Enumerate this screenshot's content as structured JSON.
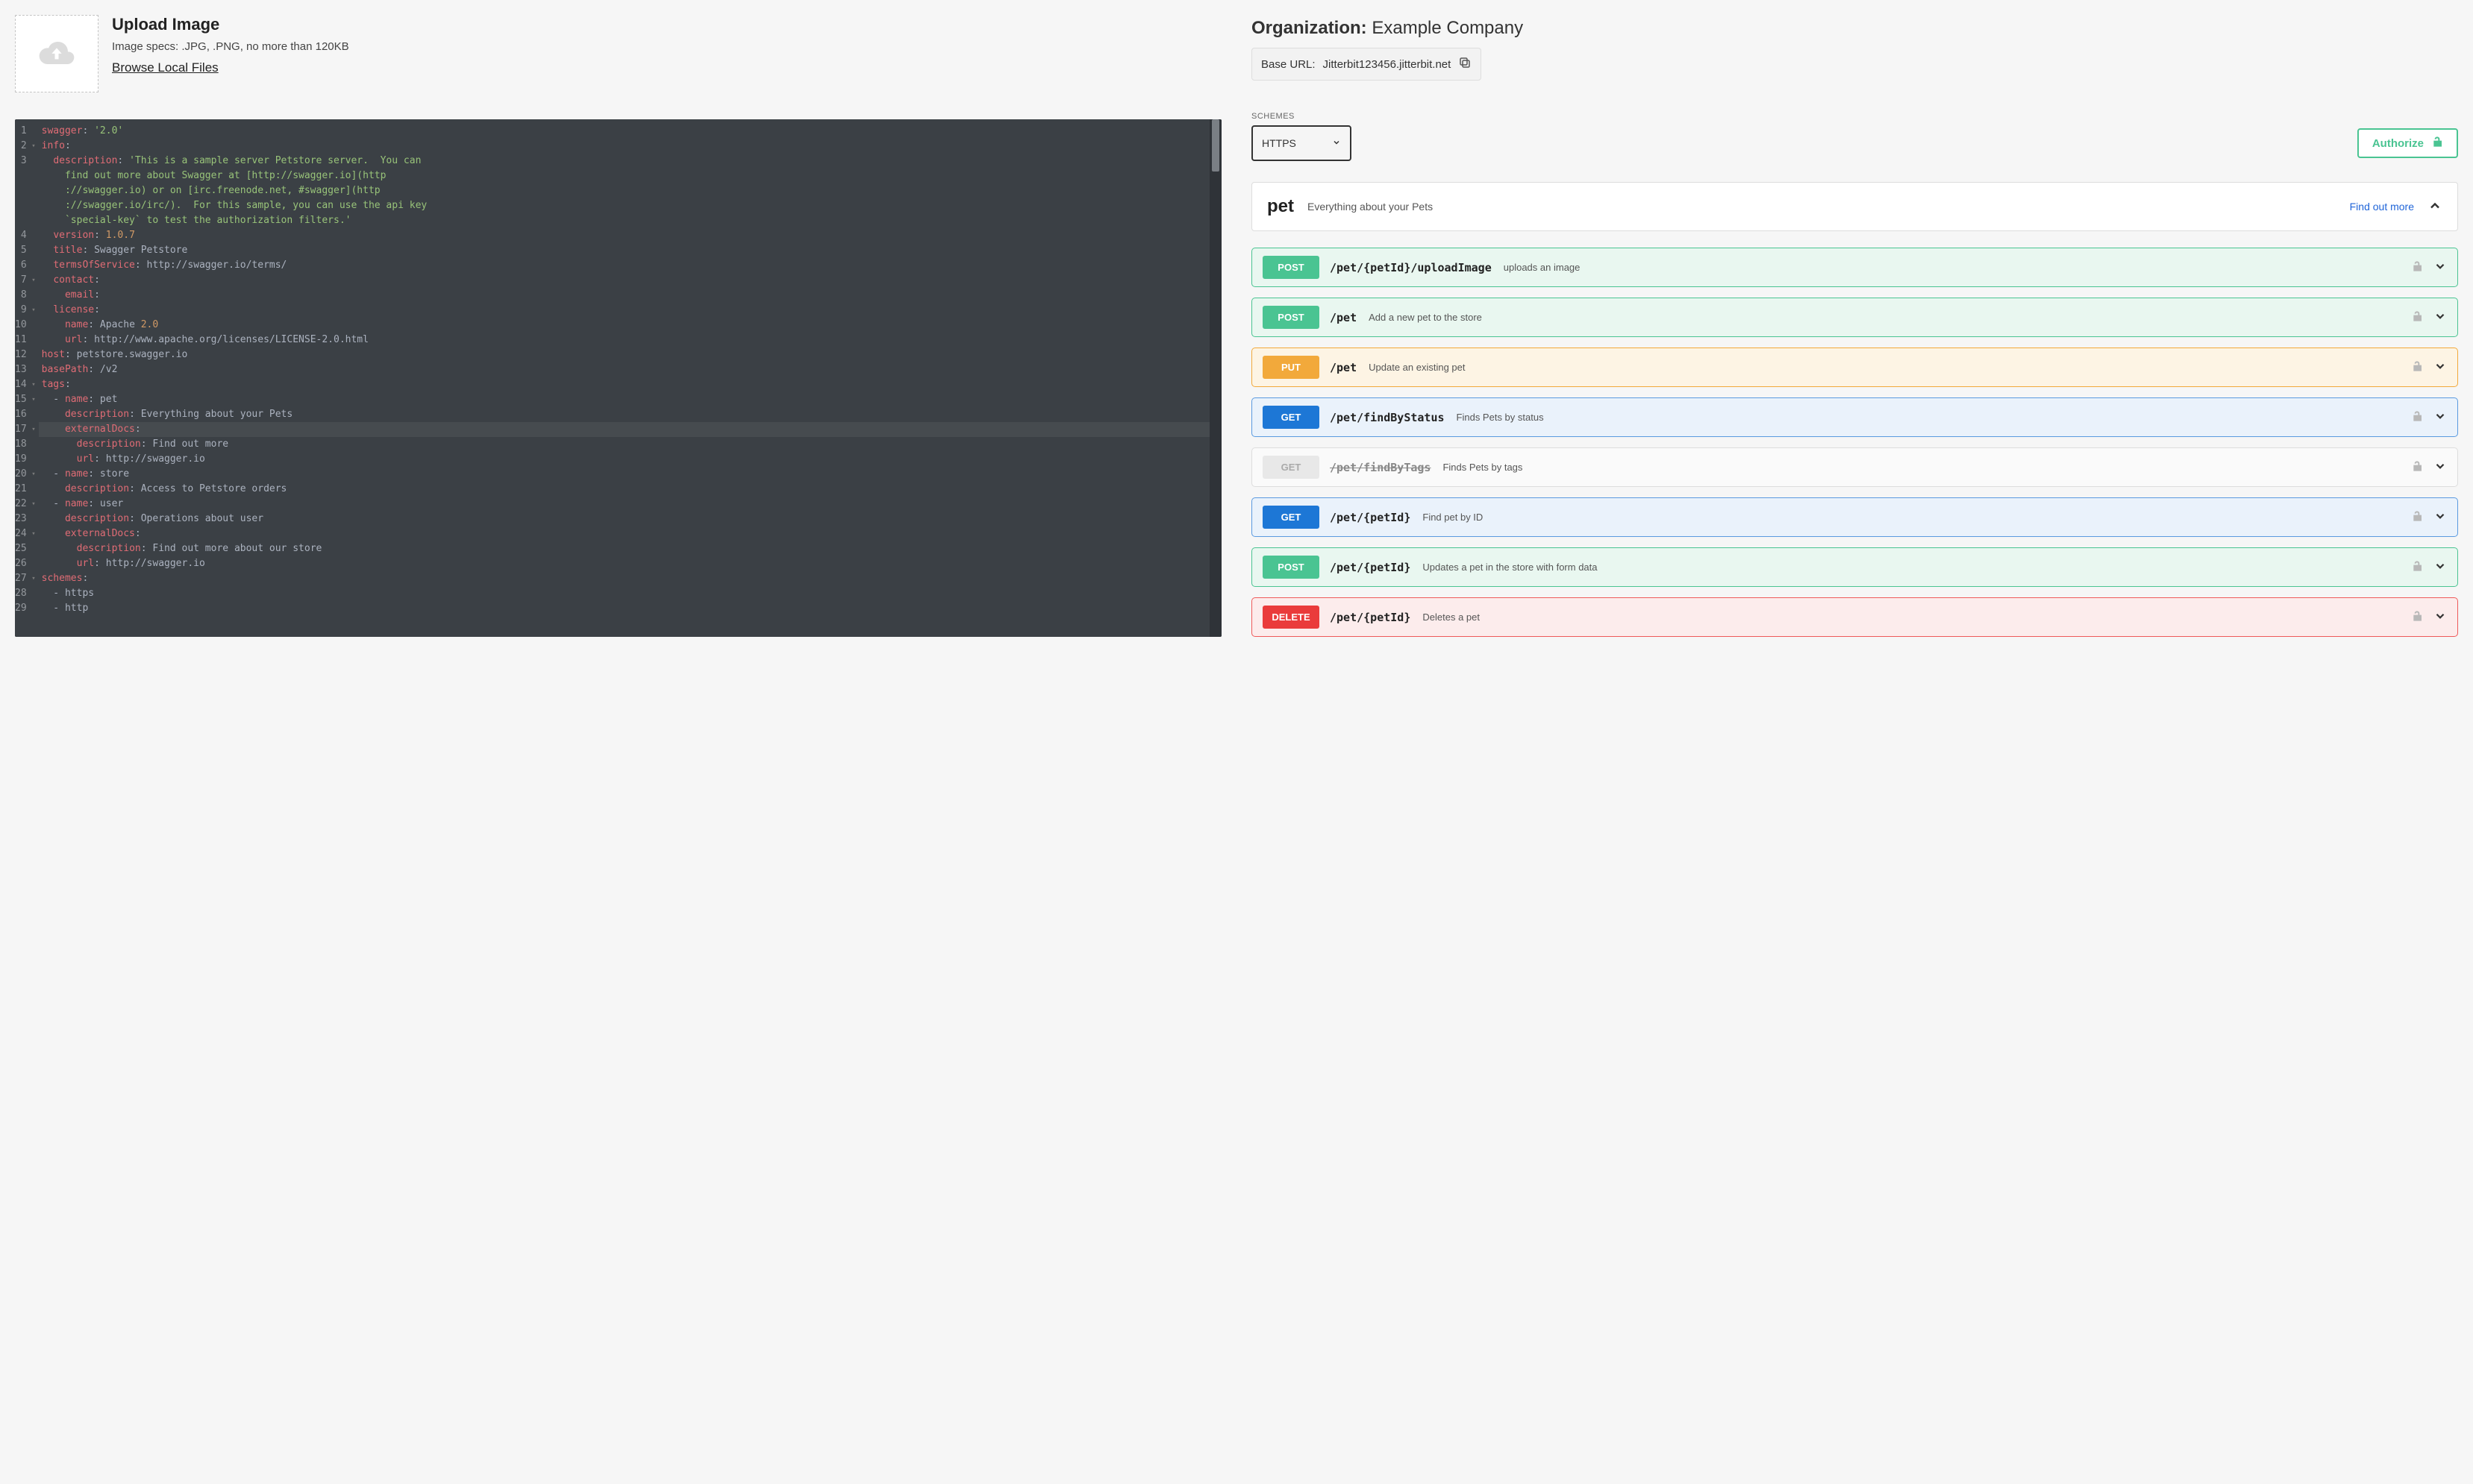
{
  "upload": {
    "title": "Upload Image",
    "specs": "Image specs: .JPG, .PNG, no more than 120KB",
    "browse": "Browse Local Files"
  },
  "editor": {
    "lines": [
      {
        "n": 1,
        "fold": false,
        "hl": false,
        "t": [
          [
            "k",
            "swagger"
          ],
          [
            "p",
            ": "
          ],
          [
            "s",
            "'2.0'"
          ]
        ]
      },
      {
        "n": 2,
        "fold": true,
        "hl": false,
        "t": [
          [
            "k",
            "info"
          ],
          [
            "p",
            ":"
          ]
        ]
      },
      {
        "n": 3,
        "fold": false,
        "hl": false,
        "t": [
          [
            "p",
            "  "
          ],
          [
            "k",
            "description"
          ],
          [
            "p",
            ": "
          ],
          [
            "s",
            "'This is a sample server Petstore server.  You can"
          ]
        ]
      },
      {
        "n": 0,
        "fold": false,
        "hl": false,
        "t": [
          [
            "s",
            "    find out more about Swagger at [http://swagger.io](http"
          ]
        ]
      },
      {
        "n": 0,
        "fold": false,
        "hl": false,
        "t": [
          [
            "s",
            "    ://swagger.io) or on [irc.freenode.net, #swagger](http"
          ]
        ]
      },
      {
        "n": 0,
        "fold": false,
        "hl": false,
        "t": [
          [
            "s",
            "    ://swagger.io/irc/).  For this sample, you can use the api key"
          ]
        ]
      },
      {
        "n": 0,
        "fold": false,
        "hl": false,
        "t": [
          [
            "s",
            "    `special-key` to test the authorization filters.'"
          ]
        ]
      },
      {
        "n": 4,
        "fold": false,
        "hl": false,
        "t": [
          [
            "p",
            "  "
          ],
          [
            "k",
            "version"
          ],
          [
            "p",
            ": "
          ],
          [
            "n",
            "1.0.7"
          ]
        ]
      },
      {
        "n": 5,
        "fold": false,
        "hl": false,
        "t": [
          [
            "p",
            "  "
          ],
          [
            "k",
            "title"
          ],
          [
            "p",
            ": Swagger Petstore"
          ]
        ]
      },
      {
        "n": 6,
        "fold": false,
        "hl": false,
        "t": [
          [
            "p",
            "  "
          ],
          [
            "k",
            "termsOfService"
          ],
          [
            "p",
            ": http://swagger.io/terms/"
          ]
        ]
      },
      {
        "n": 7,
        "fold": true,
        "hl": false,
        "t": [
          [
            "p",
            "  "
          ],
          [
            "k",
            "contact"
          ],
          [
            "p",
            ":"
          ]
        ]
      },
      {
        "n": 8,
        "fold": false,
        "hl": false,
        "t": [
          [
            "p",
            "    "
          ],
          [
            "k",
            "email"
          ],
          [
            "p",
            ":"
          ]
        ]
      },
      {
        "n": 9,
        "fold": true,
        "hl": false,
        "t": [
          [
            "p",
            "  "
          ],
          [
            "k",
            "license"
          ],
          [
            "p",
            ":"
          ]
        ]
      },
      {
        "n": 10,
        "fold": false,
        "hl": false,
        "t": [
          [
            "p",
            "    "
          ],
          [
            "k",
            "name"
          ],
          [
            "p",
            ": Apache "
          ],
          [
            "n",
            "2.0"
          ]
        ]
      },
      {
        "n": 11,
        "fold": false,
        "hl": false,
        "t": [
          [
            "p",
            "    "
          ],
          [
            "k",
            "url"
          ],
          [
            "p",
            ": http://www.apache.org/licenses/LICENSE-2.0.html"
          ]
        ]
      },
      {
        "n": 12,
        "fold": false,
        "hl": false,
        "t": [
          [
            "k",
            "host"
          ],
          [
            "p",
            ": petstore.swagger.io"
          ]
        ]
      },
      {
        "n": 13,
        "fold": false,
        "hl": false,
        "t": [
          [
            "k",
            "basePath"
          ],
          [
            "p",
            ": /v2"
          ]
        ]
      },
      {
        "n": 14,
        "fold": true,
        "hl": false,
        "t": [
          [
            "k",
            "tags"
          ],
          [
            "p",
            ":"
          ]
        ]
      },
      {
        "n": 15,
        "fold": true,
        "hl": false,
        "t": [
          [
            "p",
            "  - "
          ],
          [
            "k",
            "name"
          ],
          [
            "p",
            ": pet"
          ]
        ]
      },
      {
        "n": 16,
        "fold": false,
        "hl": false,
        "t": [
          [
            "p",
            "    "
          ],
          [
            "k",
            "description"
          ],
          [
            "p",
            ": Everything about your Pets"
          ]
        ]
      },
      {
        "n": 17,
        "fold": true,
        "hl": true,
        "t": [
          [
            "p",
            "    "
          ],
          [
            "k",
            "externalDocs"
          ],
          [
            "p",
            ":"
          ]
        ]
      },
      {
        "n": 18,
        "fold": false,
        "hl": false,
        "t": [
          [
            "p",
            "      "
          ],
          [
            "k",
            "description"
          ],
          [
            "p",
            ": Find out more"
          ]
        ]
      },
      {
        "n": 19,
        "fold": false,
        "hl": false,
        "t": [
          [
            "p",
            "      "
          ],
          [
            "k",
            "url"
          ],
          [
            "p",
            ": http://swagger.io"
          ]
        ]
      },
      {
        "n": 20,
        "fold": true,
        "hl": false,
        "t": [
          [
            "p",
            "  - "
          ],
          [
            "k",
            "name"
          ],
          [
            "p",
            ": store"
          ]
        ]
      },
      {
        "n": 21,
        "fold": false,
        "hl": false,
        "t": [
          [
            "p",
            "    "
          ],
          [
            "k",
            "description"
          ],
          [
            "p",
            ": Access to Petstore orders"
          ]
        ]
      },
      {
        "n": 22,
        "fold": true,
        "hl": false,
        "t": [
          [
            "p",
            "  - "
          ],
          [
            "k",
            "name"
          ],
          [
            "p",
            ": user"
          ]
        ]
      },
      {
        "n": 23,
        "fold": false,
        "hl": false,
        "t": [
          [
            "p",
            "    "
          ],
          [
            "k",
            "description"
          ],
          [
            "p",
            ": Operations about user"
          ]
        ]
      },
      {
        "n": 24,
        "fold": true,
        "hl": false,
        "t": [
          [
            "p",
            "    "
          ],
          [
            "k",
            "externalDocs"
          ],
          [
            "p",
            ":"
          ]
        ]
      },
      {
        "n": 25,
        "fold": false,
        "hl": false,
        "t": [
          [
            "p",
            "      "
          ],
          [
            "k",
            "description"
          ],
          [
            "p",
            ": Find out more about our store"
          ]
        ]
      },
      {
        "n": 26,
        "fold": false,
        "hl": false,
        "t": [
          [
            "p",
            "      "
          ],
          [
            "k",
            "url"
          ],
          [
            "p",
            ": http://swagger.io"
          ]
        ]
      },
      {
        "n": 27,
        "fold": true,
        "hl": false,
        "t": [
          [
            "k",
            "schemes"
          ],
          [
            "p",
            ":"
          ]
        ]
      },
      {
        "n": 28,
        "fold": false,
        "hl": false,
        "t": [
          [
            "p",
            "  - https"
          ]
        ]
      },
      {
        "n": 29,
        "fold": false,
        "hl": false,
        "t": [
          [
            "p",
            "  - http"
          ]
        ]
      }
    ]
  },
  "org": {
    "label": "Organization:",
    "name": "Example Company",
    "base_url_label": "Base URL:",
    "base_url_value": "Jitterbit123456.jitterbit.net"
  },
  "schemes": {
    "label": "SCHEMES",
    "selected": "HTTPS"
  },
  "authorize_label": "Authorize",
  "tag": {
    "name": "pet",
    "description": "Everything about your Pets",
    "find_out_more": "Find out more"
  },
  "operations": [
    {
      "method": "POST",
      "cls": "post",
      "path": "/pet/{petId}/uploadImage",
      "summary": "uploads an image",
      "deprecated": false
    },
    {
      "method": "POST",
      "cls": "post",
      "path": "/pet",
      "summary": "Add a new pet to the store",
      "deprecated": false
    },
    {
      "method": "PUT",
      "cls": "put",
      "path": "/pet",
      "summary": "Update an existing pet",
      "deprecated": false
    },
    {
      "method": "GET",
      "cls": "get",
      "path": "/pet/findByStatus",
      "summary": "Finds Pets by status",
      "deprecated": false
    },
    {
      "method": "GET",
      "cls": "get",
      "path": "/pet/findByTags",
      "summary": "Finds Pets by tags",
      "deprecated": true
    },
    {
      "method": "GET",
      "cls": "get",
      "path": "/pet/{petId}",
      "summary": "Find pet by ID",
      "deprecated": false
    },
    {
      "method": "POST",
      "cls": "post",
      "path": "/pet/{petId}",
      "summary": "Updates a pet in the store with form data",
      "deprecated": false
    },
    {
      "method": "DELETE",
      "cls": "delete",
      "path": "/pet/{petId}",
      "summary": "Deletes a pet",
      "deprecated": false
    }
  ]
}
